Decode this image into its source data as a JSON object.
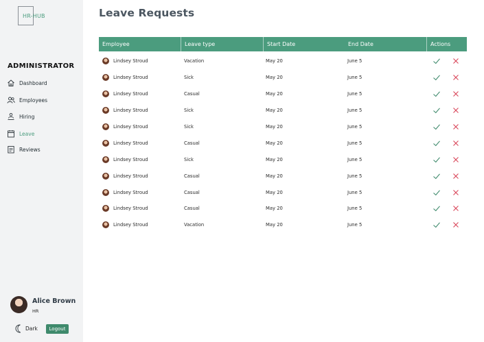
{
  "app": {
    "logo_text": "HR-HUB",
    "role_heading": "ADMINISTRATOR"
  },
  "sidebar": {
    "items": [
      {
        "label": "Dashboard",
        "icon": "home-icon",
        "active": false
      },
      {
        "label": "Employees",
        "icon": "users-icon",
        "active": false
      },
      {
        "label": "Hiring",
        "icon": "hiring-icon",
        "active": false
      },
      {
        "label": "Leave",
        "icon": "calendar-icon",
        "active": true
      },
      {
        "label": "Reviews",
        "icon": "clipboard-icon",
        "active": false
      }
    ]
  },
  "profile": {
    "name": "Alice Brown",
    "role": "HR"
  },
  "theme": {
    "label": "Dark",
    "icon": "moon-icon"
  },
  "logout_label": "Logout",
  "page": {
    "title": "Leave Requests"
  },
  "table": {
    "columns": [
      "Employee",
      "Leave type",
      "Start Date",
      "End Date",
      "Actions"
    ],
    "rows": [
      {
        "employee": "Lindsey Stroud",
        "leave_type": "Vacation",
        "start": "May 20",
        "end": "June 5"
      },
      {
        "employee": "Lindsey Stroud",
        "leave_type": "Sick",
        "start": "May 20",
        "end": "June 5"
      },
      {
        "employee": "Lindsey Stroud",
        "leave_type": "Casual",
        "start": "May 20",
        "end": "June 5"
      },
      {
        "employee": "Lindsey Stroud",
        "leave_type": "Sick",
        "start": "May 20",
        "end": "June 5"
      },
      {
        "employee": "Lindsey Stroud",
        "leave_type": "Sick",
        "start": "May 20",
        "end": "June 5"
      },
      {
        "employee": "Lindsey Stroud",
        "leave_type": "Casual",
        "start": "May 20",
        "end": "June 5"
      },
      {
        "employee": "Lindsey Stroud",
        "leave_type": "Sick",
        "start": "May 20",
        "end": "June 5"
      },
      {
        "employee": "Lindsey Stroud",
        "leave_type": "Casual",
        "start": "May 20",
        "end": "June 5"
      },
      {
        "employee": "Lindsey Stroud",
        "leave_type": "Casual",
        "start": "May 20",
        "end": "June 5"
      },
      {
        "employee": "Lindsey Stroud",
        "leave_type": "Casual",
        "start": "May 20",
        "end": "June 5"
      },
      {
        "employee": "Lindsey Stroud",
        "leave_type": "Vacation",
        "start": "May 20",
        "end": "June 5"
      }
    ]
  },
  "colors": {
    "accent": "#4b9c7e",
    "approve": "#3f8a6c",
    "reject": "#d9465a"
  }
}
